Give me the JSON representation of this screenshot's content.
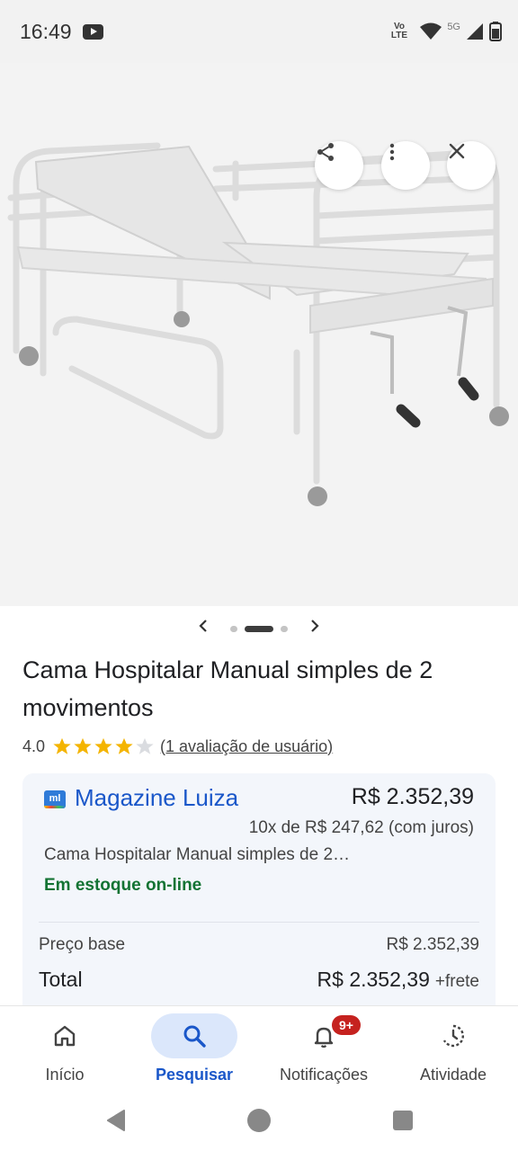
{
  "status_bar": {
    "time": "16:49",
    "volte": "Vo LTE",
    "network": "5G",
    "icons": [
      "youtube-icon",
      "wifi-icon",
      "signal-icon",
      "battery-icon"
    ]
  },
  "hero": {
    "actions": [
      "share-icon",
      "more-vert-icon",
      "close-icon"
    ],
    "carousel": {
      "total": 3,
      "active": 2
    }
  },
  "product": {
    "title": "Cama Hospitalar Manual simples de 2 movimentos",
    "rating_score": "4.0",
    "rating_value": 4,
    "rating_max": 5,
    "rating_link": "(1 avaliação de usuário)"
  },
  "offer": {
    "seller_logo_text": "ml",
    "seller": "Magazine Luiza",
    "price": "R$ 2.352,39",
    "installments": "10x de R$ 247,62 (com juros)",
    "description": "Cama Hospitalar Manual simples de 2…",
    "stock": "Em estoque on-line",
    "base_label": "Preço base",
    "base_price": "R$ 2.352,39",
    "total_label": "Total",
    "total_price": "R$ 2.352,39",
    "shipping": "+frete"
  },
  "bottom_nav": {
    "items": [
      {
        "label": "Início",
        "icon": "home-icon"
      },
      {
        "label": "Pesquisar",
        "icon": "search-icon"
      },
      {
        "label": "Notificações",
        "icon": "bell-icon",
        "badge": "9+"
      },
      {
        "label": "Atividade",
        "icon": "activity-icon"
      }
    ],
    "active_index": 1
  },
  "colors": {
    "accent": "#1a57c9",
    "stock_green": "#137333",
    "badge_red": "#c5221f",
    "star": "#f4b400"
  }
}
